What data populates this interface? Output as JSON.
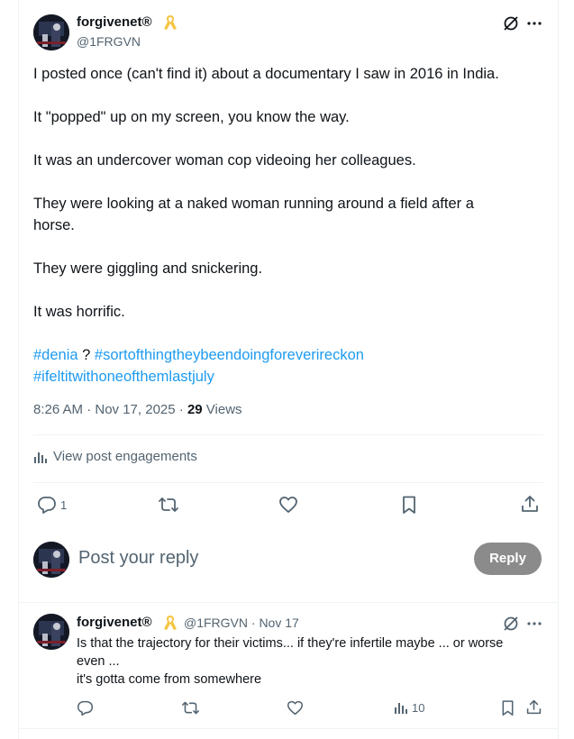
{
  "post": {
    "author_name": "forgivenet®",
    "author_handle": "@1FRGVN",
    "paragraphs": [
      "I posted once (can't find it) about a documentary I saw in 2016 in India.",
      "It \"popped\" up on my screen, you know the way.",
      "It was an undercover woman cop videoing her colleagues.",
      "They were looking at a naked woman running around a field after a",
      "horse.",
      "They were giggling and snickering.",
      "It was horrific."
    ],
    "hashtag_1": "#denia",
    "hashtag_sep": " ? ",
    "hashtag_2": "#sortofthingtheybeendoingforeverireckon",
    "hashtag_3": "#ifeltitwithoneofthemlastjuly",
    "timestamp": "8:26 AM · Nov 17, 2025 · ",
    "views_count": "29",
    "views_label": " Views",
    "engagements_label": "View post engagements",
    "reply_count": "1"
  },
  "composer": {
    "placeholder": "Post your reply",
    "button_label": "Reply"
  },
  "reply": {
    "author_name": "forgivenet®",
    "author_handle": "@1FRGVN · Nov 17",
    "line_1": "Is that the trajectory for their victims... if they're infertile maybe ... or worse",
    "line_2": "even ...",
    "line_3": "it's gotta come from somewhere",
    "views_count": "10"
  },
  "colors": {
    "accent": "#1d9bf0",
    "text": "#0f1419",
    "muted": "#536471",
    "ribbon": "#f5c542",
    "reply_button": "#8b8b8b"
  },
  "icons": [
    "grok-icon",
    "more-icon",
    "ribbon-icon",
    "analytics-icon",
    "reply-icon",
    "repost-icon",
    "like-icon",
    "bookmark-icon",
    "share-icon"
  ]
}
